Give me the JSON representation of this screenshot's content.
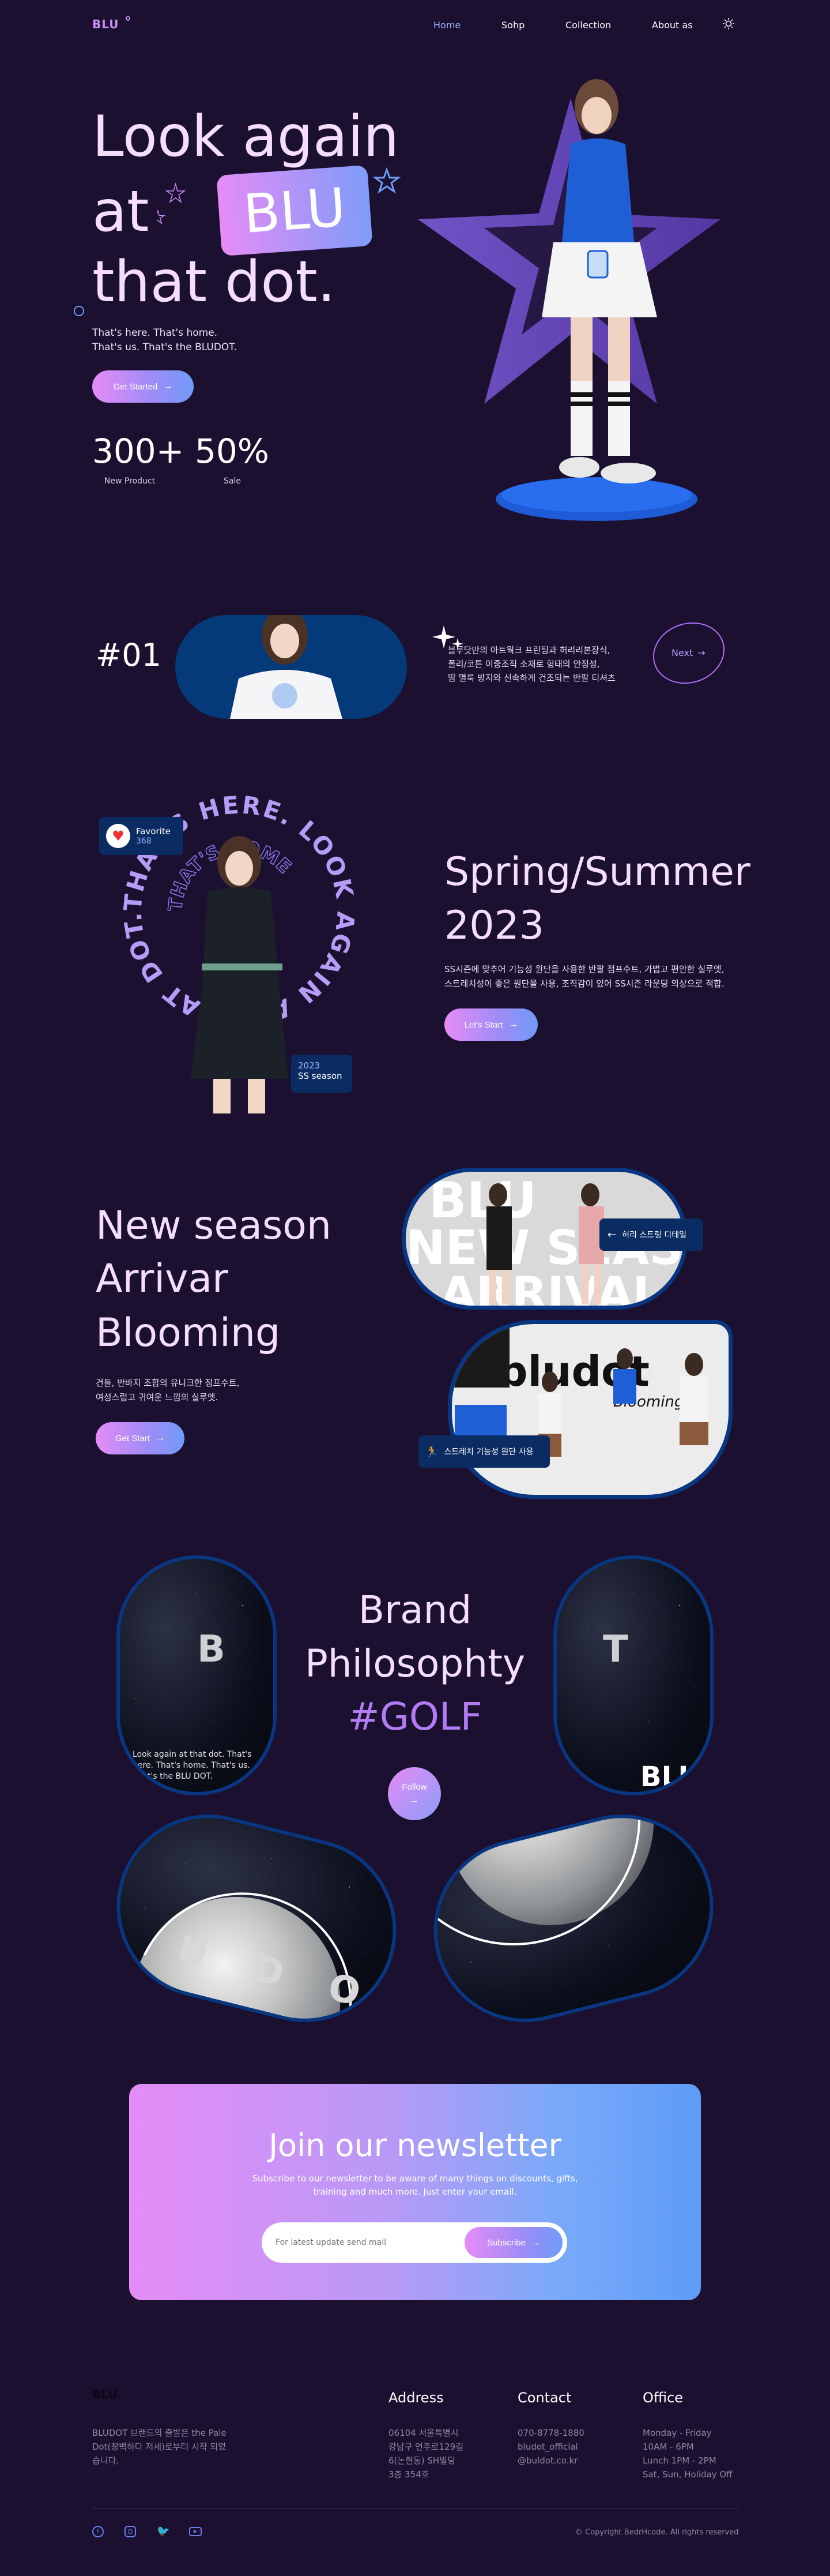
{
  "nav": {
    "logo": "BLU",
    "links": [
      "Home",
      "Sohp",
      "Collection",
      "About as"
    ],
    "active_index": 0,
    "theme_icon": "sun-icon"
  },
  "hero": {
    "line1": "Look again",
    "line2_prefix": "at",
    "badge": "BLU",
    "line3": "that dot.",
    "sub_line1": "That's here. That's home.",
    "sub_line2": "That's us. That's the BLUDOT.",
    "cta": "Get Started",
    "stats": [
      {
        "value": "300+",
        "label": "New Product"
      },
      {
        "value": "50%",
        "label": "Sale"
      }
    ]
  },
  "product_strip": {
    "number": "#01",
    "text_line1": "블루닷만의 아트웍크 프린팅과 허리리본장식,",
    "text_line2": "폴리/코튼 이중조직 소재로 형태의 안정성,",
    "text_line3": "땀 멸룩 방지와 신속하게 건조되는 반팔 티셔츠",
    "next": "Next"
  },
  "spring": {
    "ring_text": "THAT'S HERE. LOOK AGAIN AT THAT DOT. US",
    "ring_inner": "THAT'S HOME",
    "favorite_label": "Favorite",
    "favorite_count": "368",
    "season_year": "2023",
    "season_label": "SS season",
    "title_line1": "Spring/Summer",
    "title_line2": "2023",
    "body_line1": "SS시즌에 맞추어 기능성 원단을 사용한 반팔 점프수트, 가볍고 편안한 실루엣,",
    "body_line2": "스트레치성이 좋은 원단을 사용, 조직감이 있어 SS시즌 라운딩 의상으로 적합.",
    "cta": "Let's Start"
  },
  "new_season": {
    "title_line1": "New season",
    "title_line2": "Arrivar",
    "title_line3": "Blooming",
    "body_line1": "건들, 반바지 조합의 유니크한 점프수트,",
    "body_line2": "여성스럽고 귀여운 느낌의 실루엣.",
    "cta": "Get Start",
    "tag_top": "허리 스트링 디테일",
    "tag_bottom": "스트레치 기능성 원단 사용",
    "banner_text1": "BLU",
    "banner_text2": "NEW SEASON",
    "banner_text3": "ARRIVAL",
    "brand_text": "bludot",
    "brand_text2": "Blooming"
  },
  "philosophy": {
    "title_line1": "Brand",
    "title_line2": "Philosophty",
    "hashtag": "#GOLF",
    "follow": "Follow",
    "letter_b": "B",
    "letter_t": "T",
    "moon_text": "Look again at that dot. That's here. That's home. That's us. That's the BLU DOT.",
    "corner_text": "BLU",
    "arc_text": "U D O"
  },
  "newsletter": {
    "title": "Join our newsletter",
    "desc_line1": "Subscribe to our newsletter to be aware of many things on discounts, gifts,",
    "desc_line2": "training and much more. Just enter your email.",
    "placeholder": "For latest update send mail",
    "cta": "Subscribe"
  },
  "footer": {
    "logo": "BLU",
    "about_line1": "BLUDOT 브랜드의 출발은 the Pale",
    "about_line2": "Dot(창백하다 저세)로부터 시작 되었",
    "about_line3": "습니다.",
    "address_title": "Address",
    "address": [
      "06104 서울특별시",
      "강남구 언주로129길",
      "6(논현동) SH빌딩",
      "3층 354호"
    ],
    "contact_title": "Contact",
    "contact": [
      "070-8778-1880",
      "bludot_official",
      "@buldot.co.kr"
    ],
    "office_title": "Office",
    "office": [
      "Monday - Friday",
      "10AM - 6PM",
      "Lunch 1PM - 2PM",
      "Sat, Sun, Holiday Off"
    ],
    "socials": [
      "facebook-icon",
      "instagram-icon",
      "twitter-icon",
      "youtube-icon"
    ],
    "copyright": "© Copyright BedrHcode. All rights reserved"
  },
  "colors": {
    "bg": "#1b1030",
    "accent_pink": "#e58cf6",
    "accent_blue": "#6f9bf8",
    "navy": "#04397a"
  }
}
